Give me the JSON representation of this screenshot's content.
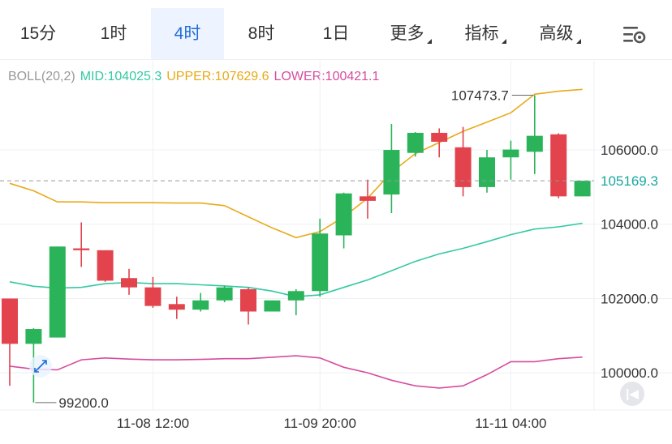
{
  "tabs": [
    {
      "label": "15分",
      "active": false,
      "dropdown": false
    },
    {
      "label": "1时",
      "active": false,
      "dropdown": false
    },
    {
      "label": "4时",
      "active": true,
      "dropdown": false
    },
    {
      "label": "8时",
      "active": false,
      "dropdown": false
    },
    {
      "label": "1日",
      "active": false,
      "dropdown": false
    },
    {
      "label": "更多",
      "active": false,
      "dropdown": true
    },
    {
      "label": "指标",
      "active": false,
      "dropdown": true
    },
    {
      "label": "高级",
      "active": false,
      "dropdown": true
    }
  ],
  "indicator": {
    "name": "BOLL(20,2)",
    "mid_label": "MID:104025.3",
    "upper_label": "UPPER:107629.6",
    "lower_label": "LOWER:100421.1"
  },
  "colors": {
    "up": "#2bb35a",
    "down": "#e2434c",
    "mid": "#33c9a3",
    "upper": "#e8aa1b",
    "lower": "#d64c9f",
    "accent": "#1f6bd9",
    "price_tag": "#1aa7a1"
  },
  "chart_data": {
    "type": "candlestick",
    "ylim": [
      99000,
      108400
    ],
    "y_ticks": [
      100000,
      102000,
      104000,
      106000
    ],
    "y_tick_labels": [
      "100000.0",
      "102000.0",
      "104000.0",
      "106000.0"
    ],
    "x_tick_labels": [
      {
        "index": 6,
        "label": "11-08 12:00"
      },
      {
        "index": 13,
        "label": "11-09 20:00"
      },
      {
        "index": 21,
        "label": "11-11 04:00"
      }
    ],
    "current_price": 105169.3,
    "current_price_label": "105169.3",
    "max_annotation": {
      "index": 22,
      "value": 107473.7,
      "label": "107473.7"
    },
    "min_annotation": {
      "index": 1,
      "value": 99200.0,
      "label": "99200.0"
    },
    "candles": [
      {
        "o": 102000,
        "h": 102000,
        "l": 99650,
        "c": 100780
      },
      {
        "o": 100780,
        "h": 101200,
        "l": 99200,
        "c": 101180
      },
      {
        "o": 100950,
        "h": 103400,
        "l": 100950,
        "c": 103400
      },
      {
        "o": 103350,
        "h": 104050,
        "l": 102850,
        "c": 103300
      },
      {
        "o": 103300,
        "h": 103300,
        "l": 102450,
        "c": 102480
      },
      {
        "o": 102550,
        "h": 102800,
        "l": 102100,
        "c": 102300
      },
      {
        "o": 102300,
        "h": 102580,
        "l": 101750,
        "c": 101800
      },
      {
        "o": 101850,
        "h": 102050,
        "l": 101450,
        "c": 101700
      },
      {
        "o": 101700,
        "h": 102150,
        "l": 101650,
        "c": 101950
      },
      {
        "o": 101950,
        "h": 102350,
        "l": 101900,
        "c": 102300
      },
      {
        "o": 102250,
        "h": 102300,
        "l": 101300,
        "c": 101650
      },
      {
        "o": 101650,
        "h": 101950,
        "l": 101650,
        "c": 101950
      },
      {
        "o": 101950,
        "h": 102250,
        "l": 101550,
        "c": 102200
      },
      {
        "o": 102200,
        "h": 104150,
        "l": 102050,
        "c": 103750
      },
      {
        "o": 103700,
        "h": 104850,
        "l": 103350,
        "c": 104830
      },
      {
        "o": 104750,
        "h": 105200,
        "l": 104150,
        "c": 104630
      },
      {
        "o": 104800,
        "h": 106700,
        "l": 104300,
        "c": 106000
      },
      {
        "o": 105920,
        "h": 106480,
        "l": 105820,
        "c": 106460
      },
      {
        "o": 106460,
        "h": 106580,
        "l": 105800,
        "c": 106220
      },
      {
        "o": 106070,
        "h": 106620,
        "l": 104750,
        "c": 105000
      },
      {
        "o": 105000,
        "h": 106000,
        "l": 104850,
        "c": 105800
      },
      {
        "o": 105800,
        "h": 106250,
        "l": 105200,
        "c": 106010
      },
      {
        "o": 105950,
        "h": 107473.7,
        "l": 105350,
        "c": 106380
      },
      {
        "o": 106420,
        "h": 106450,
        "l": 104700,
        "c": 104750
      },
      {
        "o": 104750,
        "h": 105170,
        "l": 104750,
        "c": 105169.3
      }
    ],
    "series": [
      {
        "name": "UPPER",
        "values": [
          105100,
          104900,
          104600,
          104600,
          104580,
          104580,
          104580,
          104570,
          104570,
          104500,
          104200,
          103900,
          103640,
          103800,
          104200,
          104700,
          105400,
          105900,
          106200,
          106500,
          106750,
          107000,
          107500,
          107580,
          107629.6
        ]
      },
      {
        "name": "MID",
        "values": [
          102450,
          102330,
          102280,
          102300,
          102400,
          102430,
          102400,
          102400,
          102370,
          102340,
          102300,
          102200,
          102050,
          102100,
          102300,
          102500,
          102750,
          103000,
          103200,
          103350,
          103530,
          103720,
          103870,
          103930,
          104025.3
        ]
      },
      {
        "name": "LOWER",
        "values": [
          100180,
          100100,
          100080,
          100350,
          100400,
          100370,
          100350,
          100350,
          100360,
          100380,
          100380,
          100420,
          100460,
          100400,
          100150,
          100000,
          99800,
          99650,
          99590,
          99650,
          99950,
          100300,
          100300,
          100380,
          100421.1
        ]
      }
    ]
  }
}
